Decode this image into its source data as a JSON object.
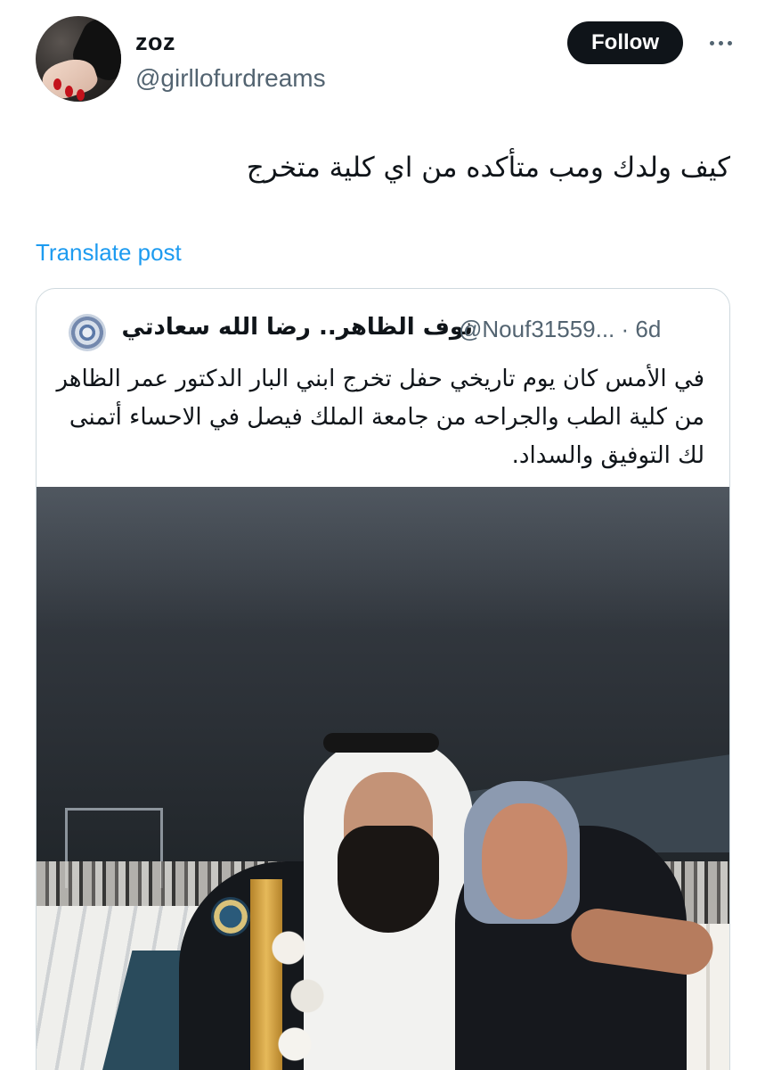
{
  "post": {
    "author": {
      "display_name": "zoz",
      "handle": "@girllofurdreams",
      "avatar_icon": "avatar-photo"
    },
    "follow_label": "Follow",
    "more_icon": "more-options-icon",
    "text": "كيف ولدك ومب متأكده من اي كلية متخرج",
    "translate_label": "Translate post"
  },
  "quoted_post": {
    "author_name": "نوف الظاهر.. رضا الله سعادتي",
    "handle_time": "@Nouf31559... · 6d",
    "text": "في الأمس كان يوم تاريخي حفل تخرج ابني البار الدكتور عمر الظاهر من كلية الطب والجراحه من جامعة الملك فيصل في الاحساء أتمنى لك التوفيق والسداد.",
    "media_icon": "graduation-photo"
  },
  "colors": {
    "text_primary": "#0f1419",
    "text_secondary": "#536471",
    "link": "#1d9bf0",
    "border": "#cfd9de",
    "follow_bg": "#0f1419"
  }
}
